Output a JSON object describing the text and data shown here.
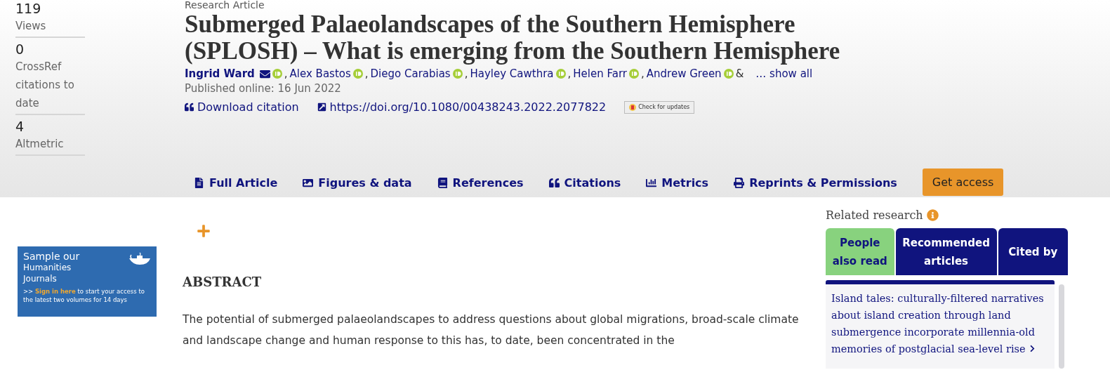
{
  "metrics": [
    {
      "value": "119",
      "label": "Views"
    },
    {
      "value": "0",
      "label": "CrossRef citations to date"
    },
    {
      "value": "4",
      "label": "Altmetric"
    }
  ],
  "article": {
    "type": "Research Article",
    "title": "Submerged Palaeolandscapes of the Southern Hemisphere (SPLOSH) – What is emerging from the Southern Hemisphere",
    "authors": [
      {
        "name": "Ingrid Ward",
        "email": true,
        "orcid": true,
        "separator": ","
      },
      {
        "name": "Alex Bastos",
        "email": false,
        "orcid": true,
        "separator": ","
      },
      {
        "name": "Diego Carabias",
        "email": false,
        "orcid": true,
        "separator": ","
      },
      {
        "name": "Hayley Cawthra",
        "email": false,
        "orcid": true,
        "separator": ","
      },
      {
        "name": "Helen Farr",
        "email": false,
        "orcid": true,
        "separator": ","
      },
      {
        "name": "Andrew Green",
        "email": false,
        "orcid": true
      }
    ],
    "ampersand": "&",
    "show_all": "… show all",
    "published": "Published online: 16 Jun 2022",
    "download_citation": "Download citation",
    "doi": "https://doi.org/10.1080/00438243.2022.2077822",
    "check_updates": "Check for updates"
  },
  "nav_tabs": [
    {
      "label": "Full Article"
    },
    {
      "label": "Figures & data"
    },
    {
      "label": "References"
    },
    {
      "label": "Citations"
    },
    {
      "label": "Metrics"
    },
    {
      "label": "Reprints & Permissions"
    }
  ],
  "get_access": "Get access",
  "banner": {
    "title": "Sample our",
    "subtitle_1": "Humanities",
    "subtitle_2": "Journals",
    "prefix": ">>",
    "link": "Sign in here",
    "text": "to start your access to the latest two volumes for 14 days"
  },
  "abstract": {
    "heading": "ABSTRACT",
    "text": "The potential of submerged palaeolandscapes to address questions about global migrations, broad-scale climate and landscape change and human response to this has, to date, been concentrated in the"
  },
  "related": {
    "title": "Related research",
    "tabs": [
      {
        "label": "People also read",
        "selected": true
      },
      {
        "label": "Recommended articles",
        "selected": false
      },
      {
        "label": "Cited by",
        "selected": false
      }
    ],
    "items": [
      "Island tales: culturally-filtered narratives about island creation through land submergence incorporate millennia-old memories of postglacial sea-level rise"
    ]
  }
}
